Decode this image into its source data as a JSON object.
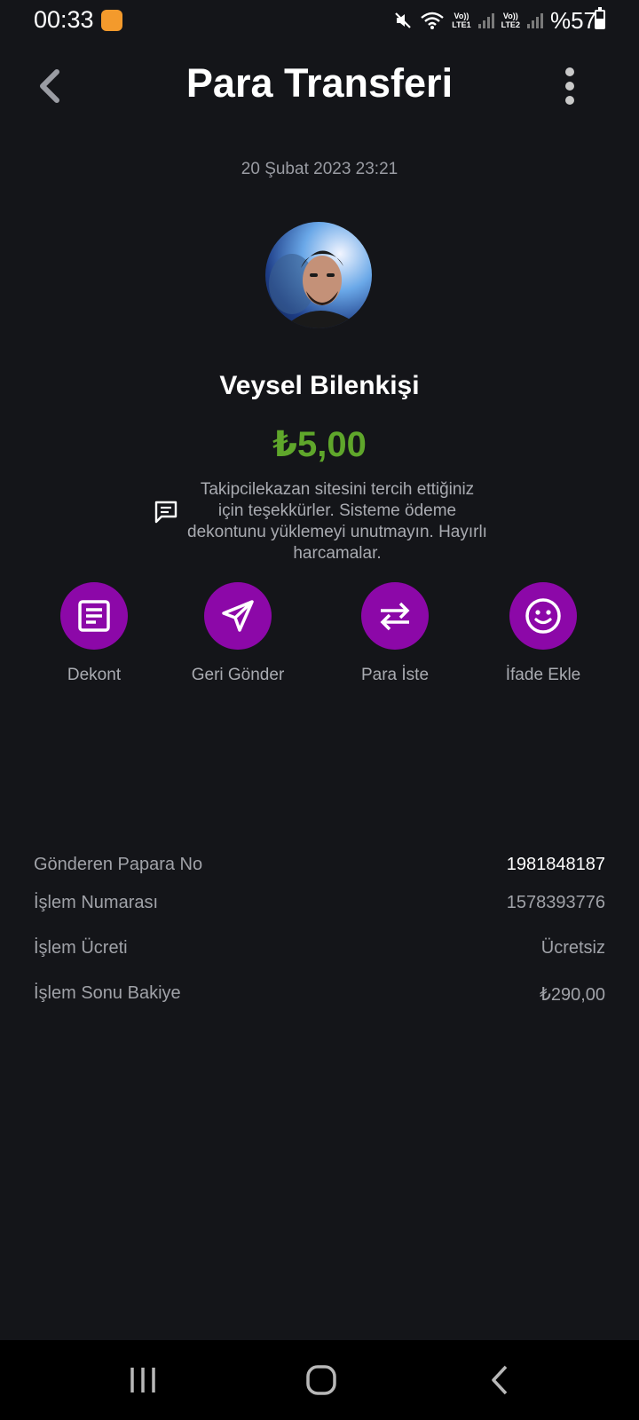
{
  "status_bar": {
    "time": "00:33",
    "lte1": "LTE1",
    "lte2": "LTE2",
    "volte": "Vo))",
    "battery_text": "%57",
    "battery_level": 0.57
  },
  "header": {
    "title": "Para Transferi"
  },
  "transaction": {
    "date": "20 Şubat 2023 23:21",
    "recipient_name": "Veysel Bilenkişi",
    "amount": "₺5,00",
    "note": "Takipcilekazan sitesini tercih ettiğiniz için teşekkürler. Sisteme ödeme dekontunu yüklemeyi unutmayın. Hayırlı harcamalar."
  },
  "actions": [
    {
      "label": "Dekont",
      "icon": "receipt-icon"
    },
    {
      "label": "Geri Gönder",
      "icon": "send-icon"
    },
    {
      "label": "Para İste",
      "icon": "swap-arrows-icon"
    },
    {
      "label": "İfade Ekle",
      "icon": "smiley-icon"
    }
  ],
  "details": [
    {
      "label": "Gönderen Papara No",
      "value": "1981848187"
    },
    {
      "label": "İşlem Numarası",
      "value": "1578393776"
    },
    {
      "label": "İşlem Ücreti",
      "value": "Ücretsiz"
    },
    {
      "label": "İşlem Sonu Bakiye",
      "value": "₺290,00"
    }
  ],
  "colors": {
    "background": "#141519",
    "accent_purple": "#8c08a8",
    "amount_green": "#5fa62b",
    "muted_text": "#a0a2a8"
  }
}
